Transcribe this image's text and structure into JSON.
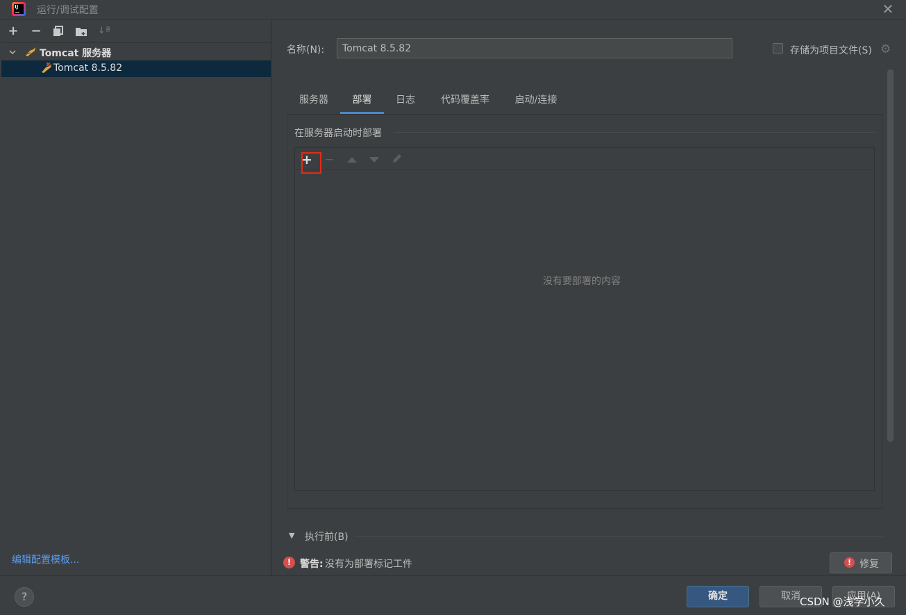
{
  "window": {
    "title": "运行/调试配置"
  },
  "left_panel": {
    "toolbar": [
      "add-icon",
      "remove-icon",
      "copy-icon",
      "folder-icon",
      "sort-icon"
    ],
    "tree": {
      "group_label": "Tomcat 服务器",
      "item_label": "Tomcat 8.5.82"
    },
    "edit_templates_link": "编辑配置模板..."
  },
  "form": {
    "name_label": "名称(N):",
    "name_value": "Tomcat 8.5.82",
    "store_label": "存储为项目文件(S)",
    "store_checked": false
  },
  "tabs": [
    {
      "label": "服务器",
      "active": false
    },
    {
      "label": "部署",
      "active": true
    },
    {
      "label": "日志",
      "active": false
    },
    {
      "label": "代码覆盖率",
      "active": false
    },
    {
      "label": "启动/连接",
      "active": false
    }
  ],
  "deploy": {
    "section_title": "在服务器启动时部署",
    "empty_text": "没有要部署的内容",
    "tools": [
      "add-icon",
      "remove-icon",
      "move-up-icon",
      "move-down-icon",
      "edit-icon"
    ]
  },
  "before_launch": {
    "label": "执行前(B)",
    "expanded": true
  },
  "warning": {
    "bold": "警告:",
    "text": "没有为部署标记工件"
  },
  "buttons": {
    "fix": "修复",
    "ok": "确定",
    "cancel": "取消",
    "apply": "应用(A)",
    "help": "?"
  },
  "watermark": "CSDN @浅学小久",
  "colors": {
    "accent": "#4a88c7",
    "selection": "#0d293e",
    "highlight_box": "#e52b14",
    "link": "#589df6",
    "warning": "#d64f4f"
  }
}
